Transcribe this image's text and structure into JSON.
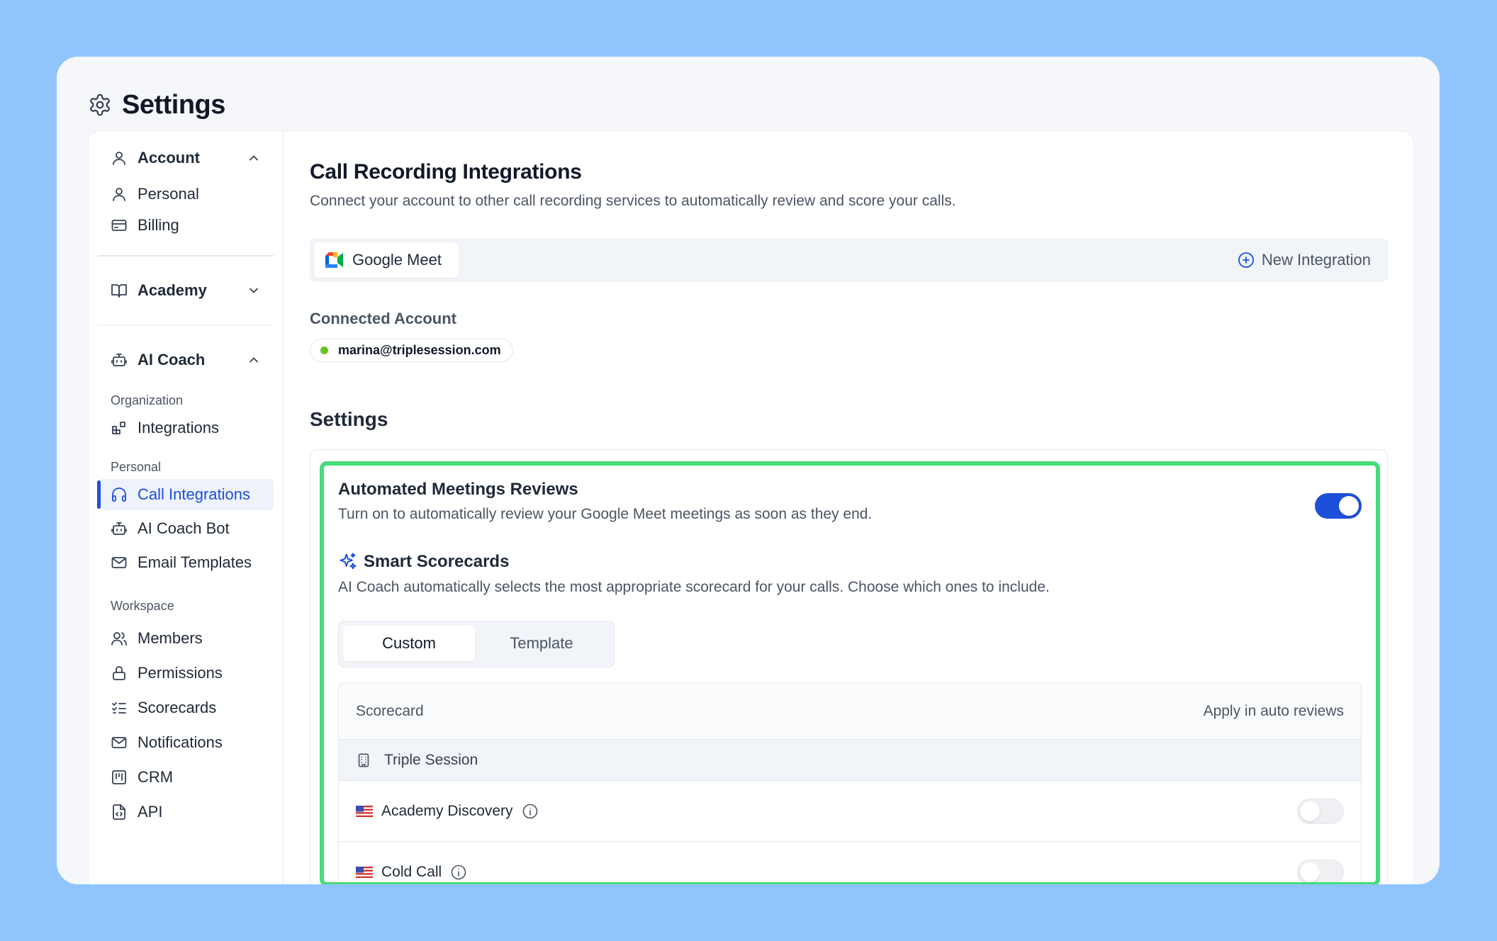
{
  "page": {
    "title": "Settings"
  },
  "sidebar": {
    "account": {
      "label": "Account",
      "items": [
        {
          "label": "Personal"
        },
        {
          "label": "Billing"
        }
      ]
    },
    "academy": {
      "label": "Academy"
    },
    "ai_coach": {
      "label": "AI Coach",
      "sections": [
        {
          "title": "Organization",
          "items": [
            {
              "label": "Integrations"
            }
          ]
        },
        {
          "title": "Personal",
          "items": [
            {
              "label": "Call Integrations"
            },
            {
              "label": "AI Coach Bot"
            },
            {
              "label": "Email Templates"
            }
          ]
        },
        {
          "title": "Workspace",
          "items": [
            {
              "label": "Members"
            },
            {
              "label": "Permissions"
            },
            {
              "label": "Scorecards"
            },
            {
              "label": "Notifications"
            },
            {
              "label": "CRM"
            },
            {
              "label": "API"
            }
          ]
        }
      ]
    }
  },
  "main": {
    "title": "Call Recording Integrations",
    "subtitle": "Connect your account to other call recording services to automatically review and score your calls.",
    "active_integration": "Google Meet",
    "new_integration_label": "New Integration",
    "connected_account_label": "Connected Account",
    "connected_email": "marina@triplesession.com",
    "settings_heading": "Settings",
    "automated_reviews": {
      "title": "Automated Meetings Reviews",
      "description": "Turn on to automatically review your Google Meet meetings as soon as they end.",
      "enabled": true
    },
    "smart_scorecards": {
      "title": "Smart Scorecards",
      "description": "AI Coach automatically selects the most appropriate scorecard for your calls. Choose which ones to include.",
      "segments": [
        "Custom",
        "Template"
      ],
      "selected_segment": "Custom"
    },
    "table": {
      "col_scorecard": "Scorecard",
      "col_apply": "Apply in auto reviews",
      "group": "Triple Session",
      "rows": [
        {
          "label": "Academy Discovery",
          "enabled": false
        },
        {
          "label": "Cold Call",
          "enabled": false
        }
      ]
    }
  },
  "colors": {
    "background": "#8fc4fd",
    "accent": "#1e4fd8",
    "highlight": "#45dd7b",
    "connected_dot": "#65c42a"
  }
}
